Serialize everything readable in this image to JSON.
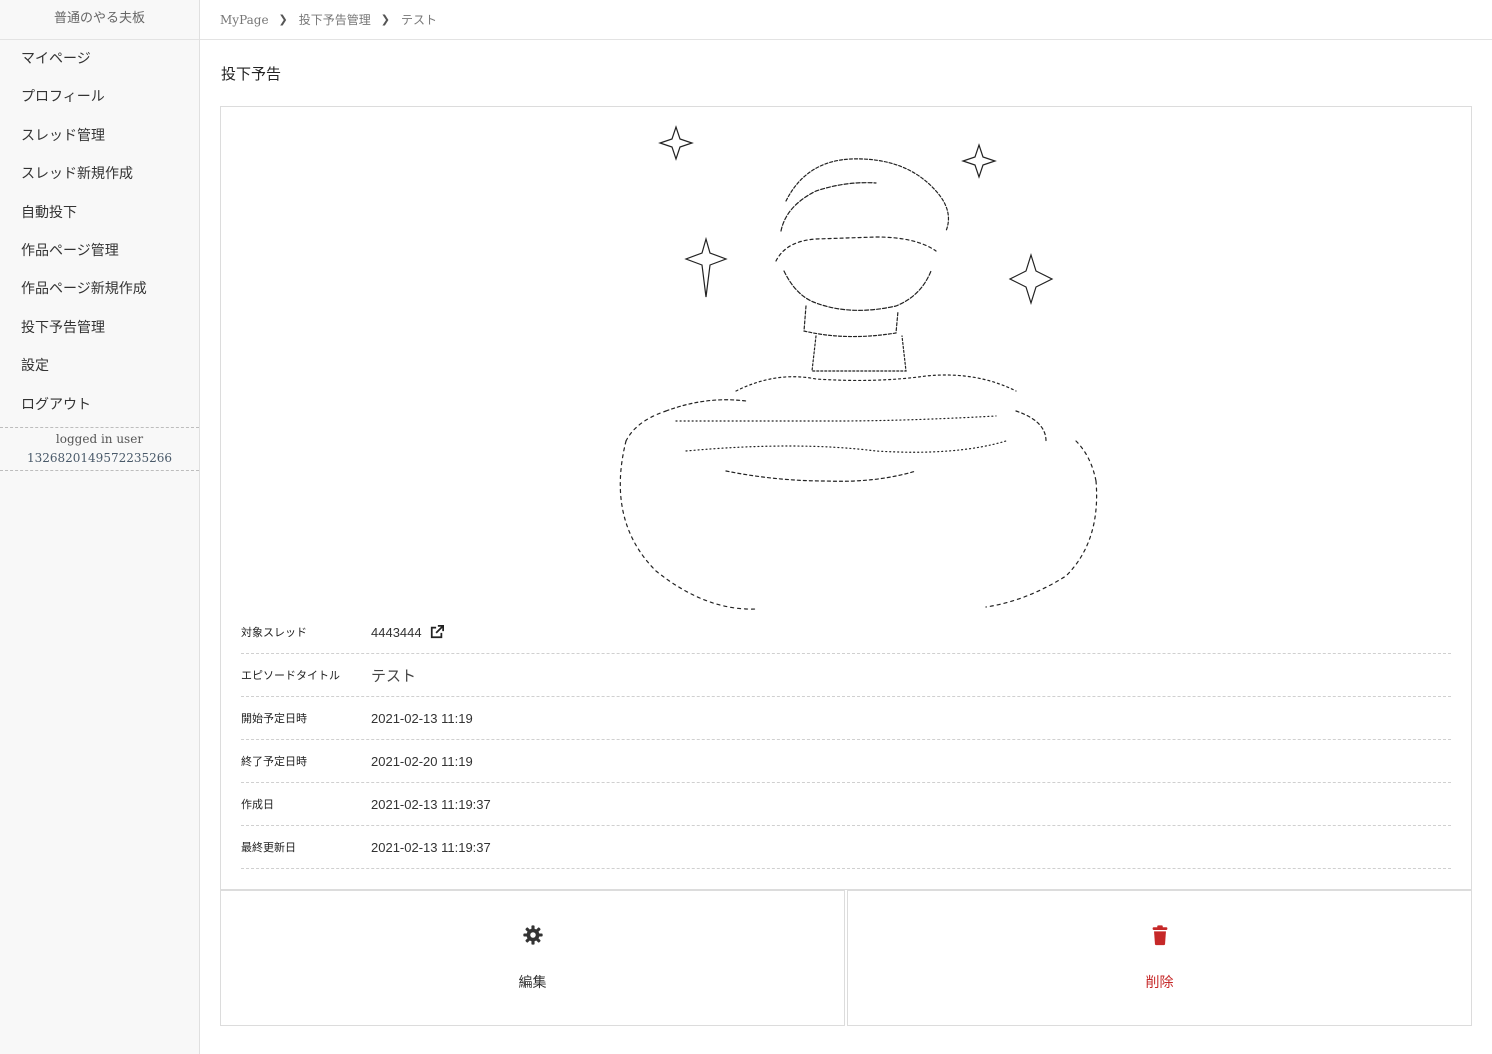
{
  "sidebar": {
    "brand": "普通のやる夫板",
    "items": [
      {
        "label": "マイページ"
      },
      {
        "label": "プロフィール"
      },
      {
        "label": "スレッド管理"
      },
      {
        "label": "スレッド新規作成"
      },
      {
        "label": "自動投下"
      },
      {
        "label": "作品ページ管理"
      },
      {
        "label": "作品ページ新規作成"
      },
      {
        "label": "投下予告管理"
      },
      {
        "label": "設定"
      },
      {
        "label": "ログアウト"
      }
    ],
    "user": {
      "label": "logged in user",
      "id": "1326820149572235266"
    }
  },
  "breadcrumb": [
    "MyPage",
    "投下予告管理",
    "テスト"
  ],
  "page_title": "投下予告",
  "details": {
    "thread": {
      "key": "対象スレッド",
      "value": "4443444"
    },
    "episode": {
      "key": "エピソードタイトル",
      "value": "テスト"
    },
    "start": {
      "key": "開始予定日時",
      "value": "2021-02-13 11:19"
    },
    "end": {
      "key": "終了予定日時",
      "value": "2021-02-20 11:19"
    },
    "created": {
      "key": "作成日",
      "value": "2021-02-13 11:19:37"
    },
    "updated": {
      "key": "最終更新日",
      "value": "2021-02-13 11:19:37"
    }
  },
  "actions": {
    "edit": {
      "label": "編集",
      "icon": "gear-icon"
    },
    "delete": {
      "label": "削除",
      "icon": "trash-icon",
      "color": "#c62828"
    }
  }
}
